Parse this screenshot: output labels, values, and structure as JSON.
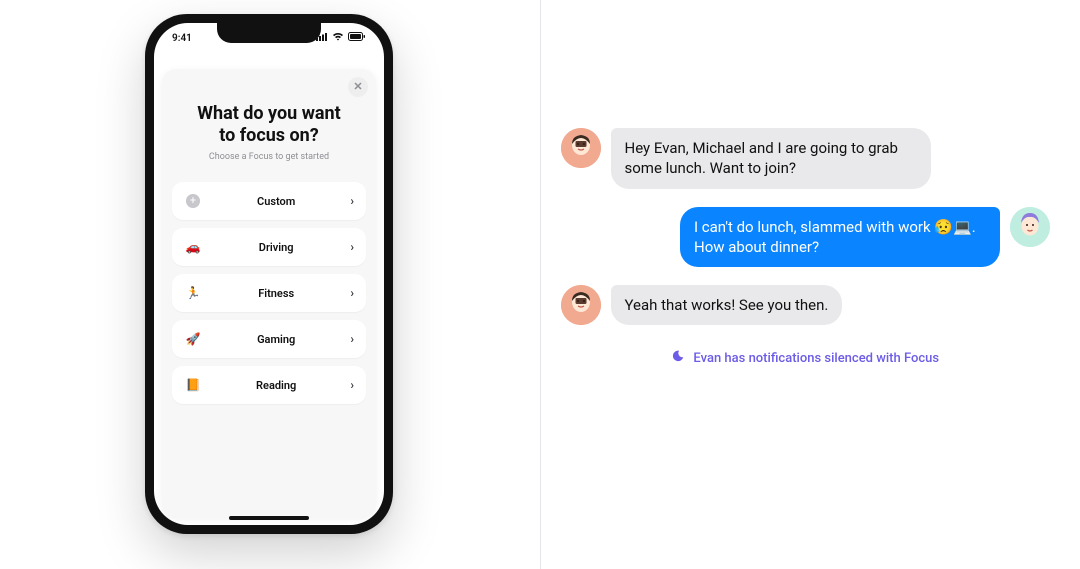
{
  "statusbar": {
    "time": "9:41"
  },
  "sheet": {
    "title_line1": "What do you want",
    "title_line2": "to focus on?",
    "subtitle": "Choose a Focus to get started"
  },
  "focus_options": [
    {
      "id": "custom",
      "label": "Custom",
      "icon": "plus-icon",
      "icon_glyph": "+"
    },
    {
      "id": "driving",
      "label": "Driving",
      "icon": "car-icon",
      "icon_glyph": "🚗"
    },
    {
      "id": "fitness",
      "label": "Fitness",
      "icon": "runner-icon",
      "icon_glyph": "🏃"
    },
    {
      "id": "gaming",
      "label": "Gaming",
      "icon": "rocket-icon",
      "icon_glyph": "🚀"
    },
    {
      "id": "reading",
      "label": "Reading",
      "icon": "book-icon",
      "icon_glyph": "📙"
    }
  ],
  "messages": {
    "m0": "Hey Evan, Michael and I are going to grab some lunch. Want to join?",
    "m1": "I can't do lunch, slammed with work 😥💻. How about dinner?",
    "m2": "Yeah that works! See you then."
  },
  "silence_notice": "Evan has notifications silenced with Focus"
}
